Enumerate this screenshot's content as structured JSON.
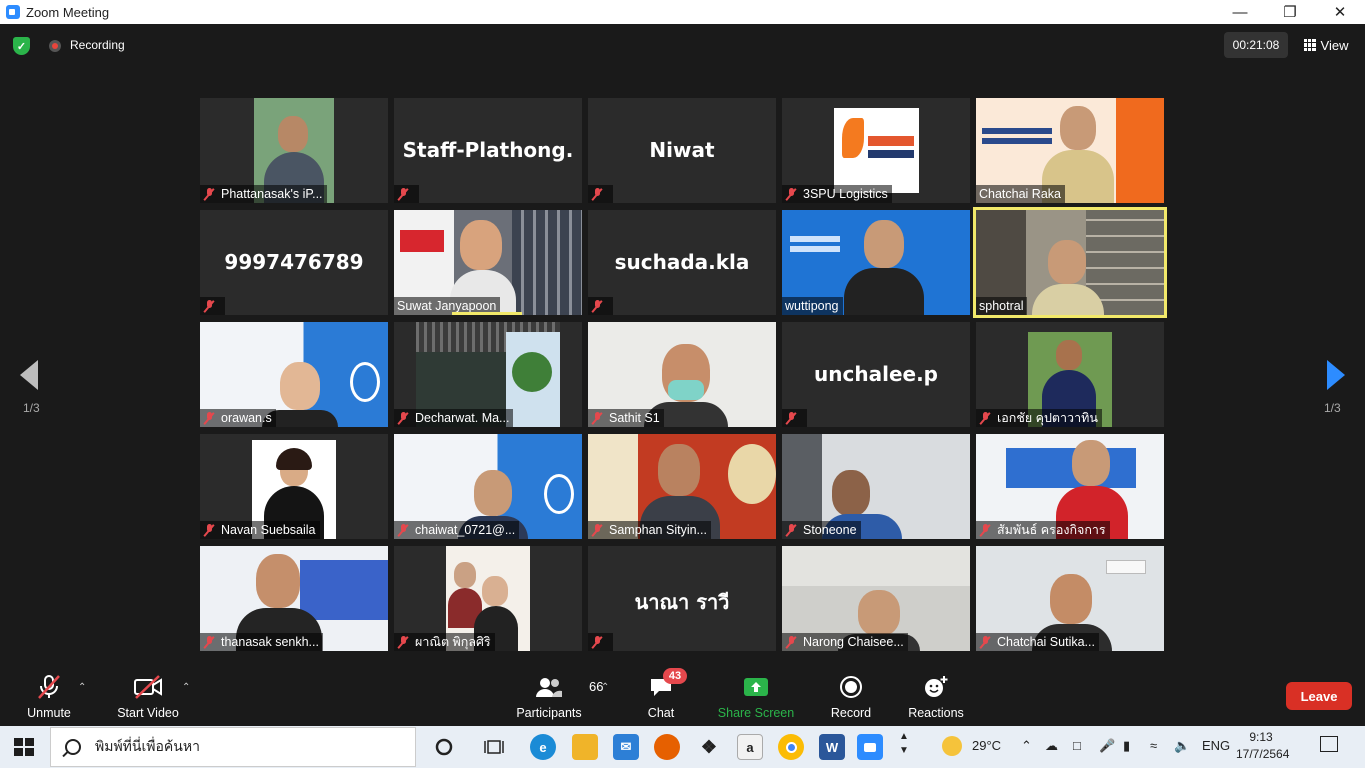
{
  "window": {
    "title": "Zoom Meeting"
  },
  "topbar": {
    "recording_label": "Recording",
    "timer": "00:21:08",
    "view_label": "View"
  },
  "participants": [
    {
      "name": "Phattanasak's iP...",
      "big": ""
    },
    {
      "name": "",
      "big": "Staff-Plathong."
    },
    {
      "name": "",
      "big": "Niwat"
    },
    {
      "name": "3SPU Logistics",
      "big": ""
    },
    {
      "name": "Chatchai Raka",
      "big": ""
    },
    {
      "name": "",
      "big": "9997476789"
    },
    {
      "name": "Suwat Janyapoon",
      "big": ""
    },
    {
      "name": "",
      "big": "suchada.kla"
    },
    {
      "name": "wuttipong",
      "big": ""
    },
    {
      "name": "sphotral",
      "big": ""
    },
    {
      "name": "orawan.s",
      "big": ""
    },
    {
      "name": "Decharwat. Ma...",
      "big": ""
    },
    {
      "name": "Sathit S1",
      "big": ""
    },
    {
      "name": "",
      "big": "unchalee.p"
    },
    {
      "name": "เอกชัย คุปตาวาทิน",
      "big": ""
    },
    {
      "name": "Navan Suebsaila",
      "big": ""
    },
    {
      "name": "chaiwat_0721@...",
      "big": ""
    },
    {
      "name": "Samphan Sityin...",
      "big": ""
    },
    {
      "name": "Stoneone",
      "big": ""
    },
    {
      "name": "สัมพันธ์ ครองกิจการ",
      "big": ""
    },
    {
      "name": "thanasak senkh...",
      "big": ""
    },
    {
      "name": "ผาณิต พิกุลศิริ",
      "big": ""
    },
    {
      "name": "",
      "big": "นาณา ราวี"
    },
    {
      "name": "Narong Chaisee...",
      "big": ""
    },
    {
      "name": "Chatchai Sutika...",
      "big": ""
    }
  ],
  "pagination": {
    "left": "1/3",
    "right": "1/3"
  },
  "toolbar": {
    "unmute": "Unmute",
    "start_video": "Start Video",
    "participants_label": "Participants",
    "participants_count": "66",
    "chat_label": "Chat",
    "chat_badge": "43",
    "share_label": "Share Screen",
    "record_label": "Record",
    "reactions_label": "Reactions",
    "leave_label": "Leave"
  },
  "taskbar": {
    "search_placeholder": "พิมพ์ที่นี่เพื่อค้นหา",
    "temperature": "29°C",
    "language": "ENG",
    "time": "9:13",
    "date": "17/7/2564"
  },
  "colors": {
    "accent": "#2d8cff",
    "leave": "#d93025",
    "active_speaker": "#f2e96a",
    "share": "#2bb44a"
  }
}
